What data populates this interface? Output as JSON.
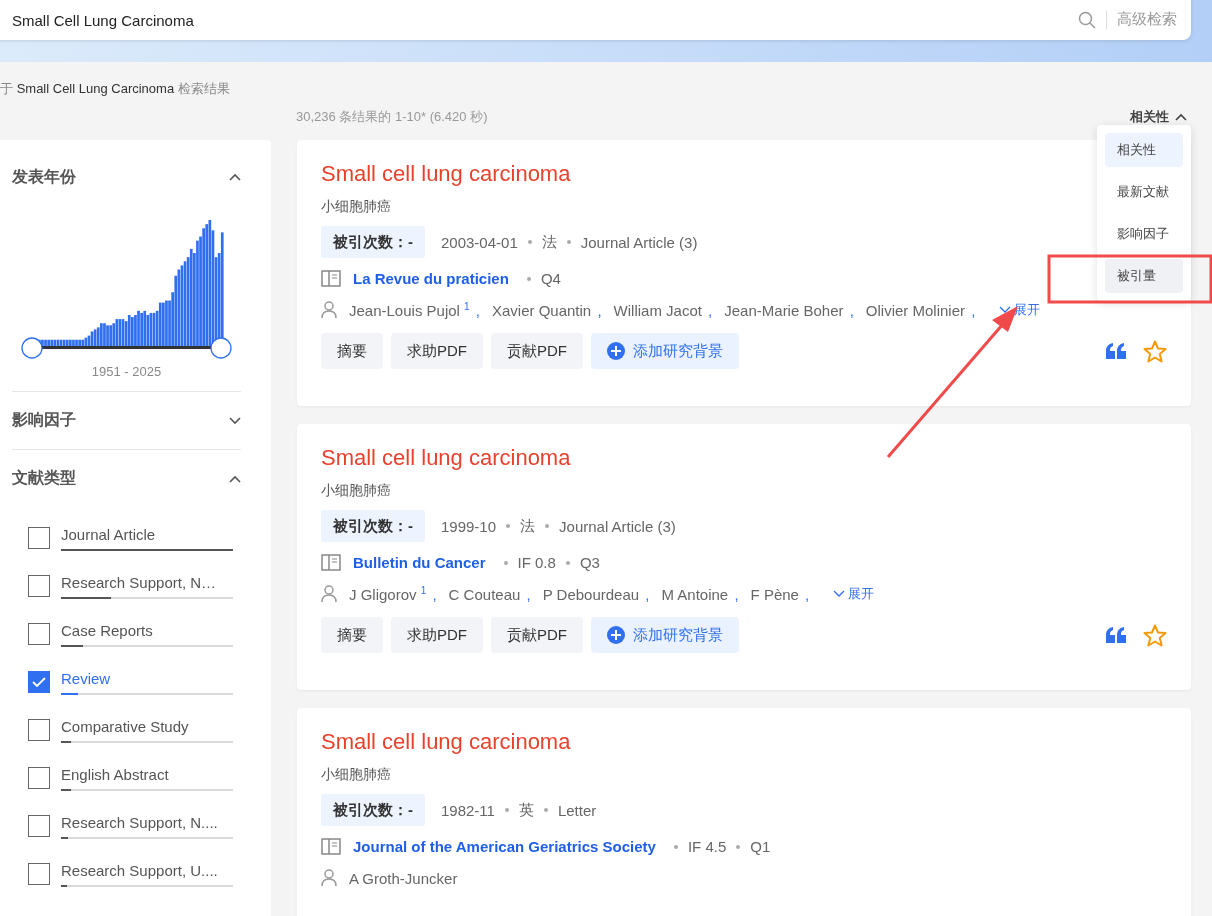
{
  "search": {
    "value": "Small Cell Lung Carcinoma",
    "advanced_label": "高级检索"
  },
  "summary": {
    "prefix": "于",
    "query": "Small Cell Lung Carcinoma",
    "suffix": "检索结果"
  },
  "result_count": "30,236 条结果的 1-10* (6.420 秒)",
  "sort": {
    "label": "相关性",
    "expanded": true,
    "options": [
      {
        "label": "相关性",
        "selected": true,
        "hovered": false
      },
      {
        "label": "最新文献",
        "selected": false,
        "hovered": false
      },
      {
        "label": "影响因子",
        "selected": false,
        "hovered": false
      },
      {
        "label": "被引量",
        "selected": false,
        "hovered": true
      }
    ]
  },
  "filters": [
    {
      "kind": "histogram",
      "title": "发表年份",
      "expanded": true,
      "range_label": "1951 - 2025"
    },
    {
      "title": "影响因子",
      "expanded": false
    },
    {
      "kind": "checklist",
      "title": "文献类型",
      "expanded": true,
      "items": [
        {
          "label": "Journal Article",
          "checked": false,
          "level": 1.0
        },
        {
          "label": "Research Support, N…",
          "checked": false,
          "level": 0.29
        },
        {
          "label": "Case Reports",
          "checked": false,
          "level": 0.13
        },
        {
          "label": "Review",
          "checked": true,
          "level": 0.1
        },
        {
          "label": "Comparative Study",
          "checked": false,
          "level": 0.06
        },
        {
          "label": "English Abstract",
          "checked": false,
          "level": 0.06
        },
        {
          "label": "Research Support, N....",
          "checked": false,
          "level": 0.04
        },
        {
          "label": "Research Support, U....",
          "checked": false,
          "level": 0.035
        }
      ]
    }
  ],
  "results": [
    {
      "title": "Small cell lung carcinoma",
      "translation": "小细胞肺癌",
      "citations": "被引次数：-",
      "meta": [
        "2003-04-01",
        "法",
        "Journal Article (3)"
      ],
      "journal": "La Revue du praticien",
      "metrics": [
        "Q4"
      ],
      "authors": [
        {
          "name": "Jean-Louis Pujol",
          "sup": "1",
          "sep": ","
        },
        {
          "name": "Xavier Quantin",
          "sep": ","
        },
        {
          "name": "William Jacot",
          "sep": ","
        },
        {
          "name": "Jean-Marie Boher",
          "sep": ","
        },
        {
          "name": "Olivier Molinier",
          "sep": ","
        }
      ],
      "expand_label": "展开",
      "buttons": [
        "摘要",
        "求助PDF",
        "贡献PDF"
      ],
      "add_label": "添加研究背景"
    },
    {
      "title": "Small cell lung carcinoma",
      "translation": "小细胞肺癌",
      "citations": "被引次数：-",
      "meta": [
        "1999-10",
        "法",
        "Journal Article (3)"
      ],
      "journal": "Bulletin du Cancer",
      "metrics": [
        "IF 0.8",
        "Q3"
      ],
      "authors": [
        {
          "name": "J Gligorov",
          "sup": "1",
          "sep": ","
        },
        {
          "name": "C Couteau",
          "sep": ","
        },
        {
          "name": "P Debourdeau",
          "sep": ","
        },
        {
          "name": "M Antoine",
          "sep": ","
        },
        {
          "name": "F Pène",
          "sep": ","
        }
      ],
      "expand_label": "展开",
      "buttons": [
        "摘要",
        "求助PDF",
        "贡献PDF"
      ],
      "add_label": "添加研究背景"
    },
    {
      "title": "Small cell lung carcinoma",
      "translation": "小细胞肺癌",
      "citations": "被引次数：-",
      "meta": [
        "1982-11",
        "英",
        "Letter"
      ],
      "journal": "Journal of the American Geriatrics Society",
      "metrics": [
        "IF 4.5",
        "Q1"
      ],
      "authors": [
        {
          "name": "A Groth-Juncker"
        }
      ]
    }
  ]
}
